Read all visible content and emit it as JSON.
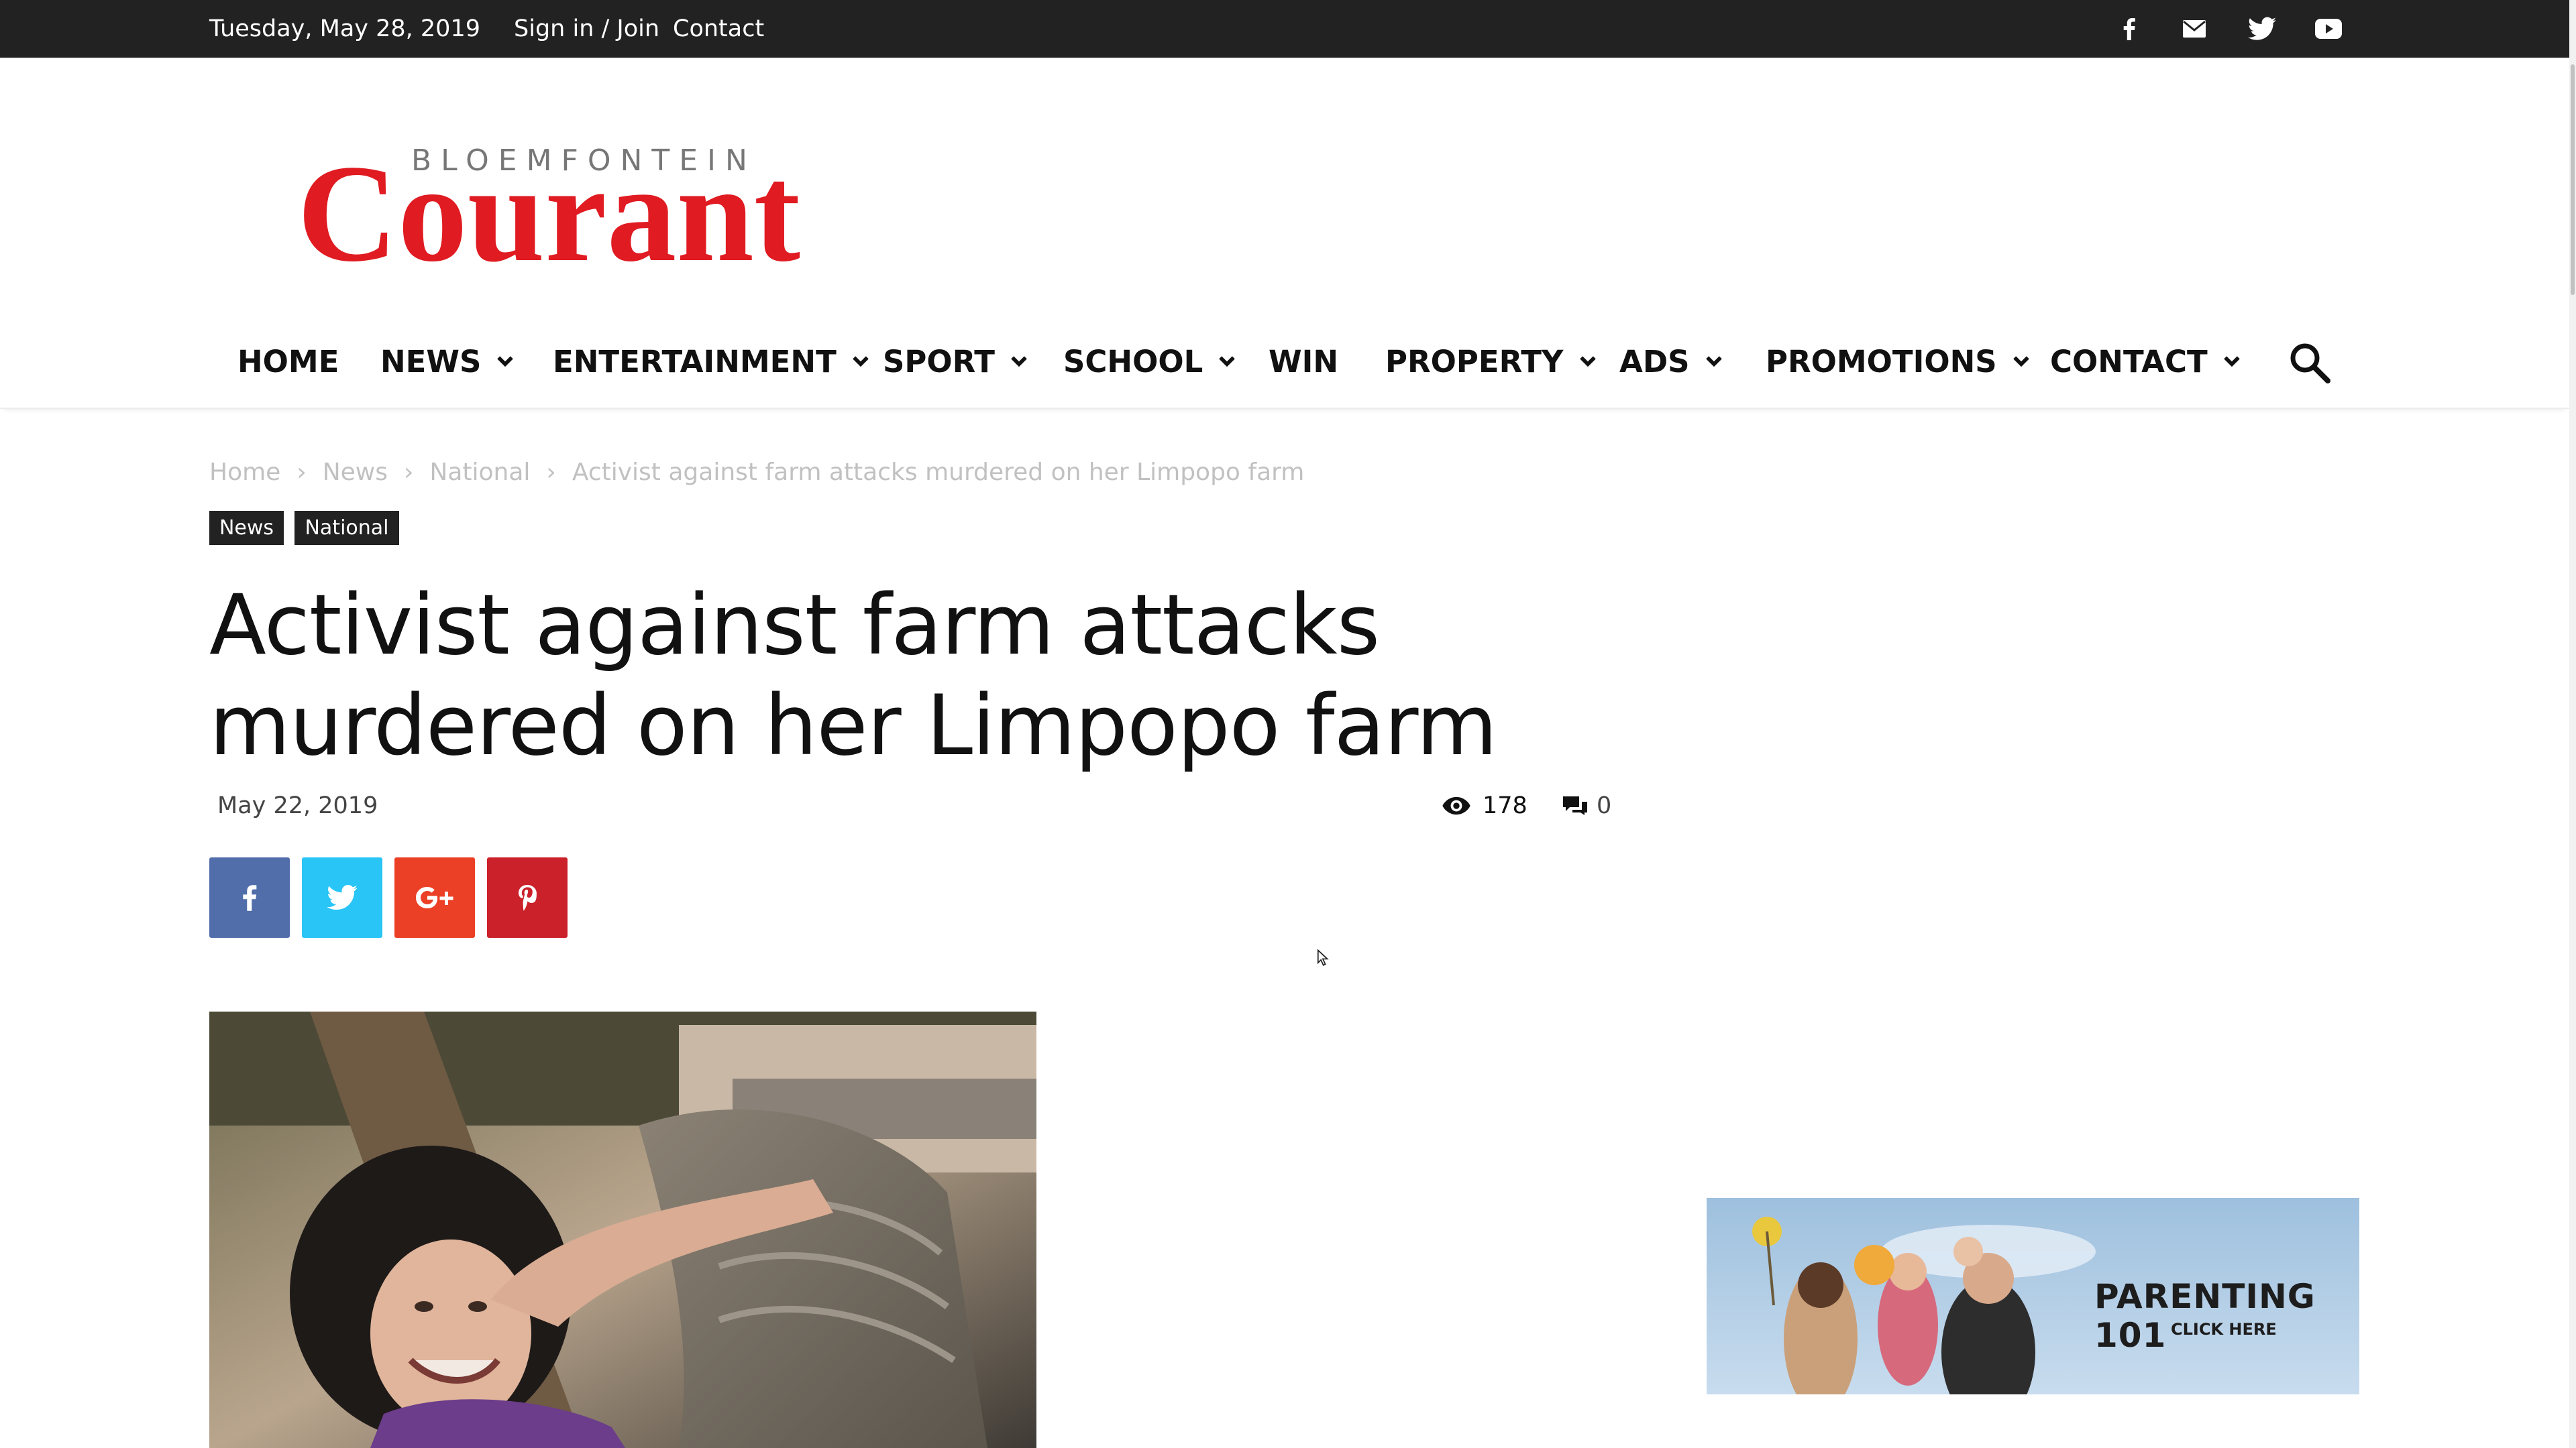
{
  "topbar": {
    "date": "Tuesday, May 28, 2019",
    "signin": "Sign in / Join",
    "contact": "Contact",
    "social_icons": [
      "facebook-icon",
      "mail-icon",
      "twitter-icon",
      "youtube-icon"
    ]
  },
  "logo": {
    "top": "BLOEMFONTEIN",
    "main": "Courant",
    "color": "#e01b22"
  },
  "nav": {
    "items": [
      {
        "label": "HOME",
        "dropdown": false
      },
      {
        "label": "NEWS",
        "dropdown": true
      },
      {
        "label": "ENTERTAINMENT",
        "dropdown": true
      },
      {
        "label": "SPORT",
        "dropdown": true
      },
      {
        "label": "SCHOOL",
        "dropdown": true
      },
      {
        "label": "WIN",
        "dropdown": false
      },
      {
        "label": "PROPERTY",
        "dropdown": true
      },
      {
        "label": "ADS",
        "dropdown": true
      },
      {
        "label": "PROMOTIONS",
        "dropdown": true
      },
      {
        "label": "CONTACT",
        "dropdown": true
      }
    ]
  },
  "breadcrumb": [
    "Home",
    "News",
    "National",
    "Activist against farm attacks murdered on her Limpopo farm"
  ],
  "tags": [
    "News",
    "National"
  ],
  "article": {
    "title_line1": "Activist against farm attacks",
    "title_line2": "murdered on her Limpopo farm",
    "date": "May 22, 2019",
    "views": "178",
    "comments": "0"
  },
  "share": [
    {
      "icon": "facebook-icon",
      "color": "#516eab"
    },
    {
      "icon": "twitter-icon",
      "color": "#29c5f6"
    },
    {
      "icon": "google-plus-icon",
      "color": "#eb4026"
    },
    {
      "icon": "pinterest-icon",
      "color": "#ca212a"
    }
  ],
  "ad": {
    "title": "PARENTING 101",
    "subtitle": "CLICK HERE"
  }
}
